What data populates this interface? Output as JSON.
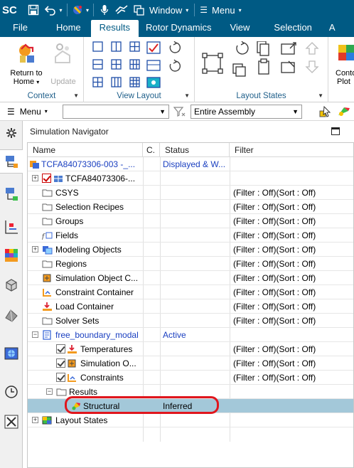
{
  "titlebar": {
    "app_logo": "SC",
    "window_label": "Window",
    "menu_label": "Menu",
    "icons": [
      "save-icon",
      "undo-icon",
      "selection-filter-icon",
      "microphone-icon",
      "touch-mode-icon",
      "window-icon",
      "hamburger-menu-icon"
    ]
  },
  "tabs": [
    {
      "label": "File",
      "active": false
    },
    {
      "label": "Home",
      "active": false
    },
    {
      "label": "Results",
      "active": true
    },
    {
      "label": "Rotor Dynamics",
      "active": false
    },
    {
      "label": "View",
      "active": false
    },
    {
      "label": "Selection",
      "active": false
    },
    {
      "label": "A",
      "active": false
    }
  ],
  "ribbon": {
    "context": {
      "label": "Context",
      "return_to_home_line1": "Return to",
      "return_to_home_line2": "Home",
      "update": "Update"
    },
    "view_layout": {
      "label": "View Layout"
    },
    "layout_states": {
      "label": "Layout States"
    },
    "contour_plot_line1": "Conto",
    "contour_plot_line2": "Plot"
  },
  "toolbar": {
    "menu_label": "Menu",
    "filter_combo_value": "",
    "assembly_combo_value": "Entire Assembly"
  },
  "navigator": {
    "title": "Simulation Navigator",
    "columns": {
      "name": "Name",
      "c": "C.",
      "status": "Status",
      "filter": "Filter"
    },
    "rows": [
      {
        "name": "TCFA84073306-003 -_...",
        "status": "Displayed & W...",
        "filter": ""
      },
      {
        "name": "TCFA84073306-...",
        "status": "",
        "filter": ""
      },
      {
        "name": "CSYS",
        "status": "",
        "filter": "(Filter : Off)(Sort : Off)"
      },
      {
        "name": "Selection Recipes",
        "status": "",
        "filter": "(Filter : Off)(Sort : Off)"
      },
      {
        "name": "Groups",
        "status": "",
        "filter": "(Filter : Off)(Sort : Off)"
      },
      {
        "name": "Fields",
        "status": "",
        "filter": "(Filter : Off)(Sort : Off)"
      },
      {
        "name": "Modeling Objects",
        "status": "",
        "filter": "(Filter : Off)(Sort : Off)"
      },
      {
        "name": "Regions",
        "status": "",
        "filter": "(Filter : Off)(Sort : Off)"
      },
      {
        "name": "Simulation Object C...",
        "status": "",
        "filter": "(Filter : Off)(Sort : Off)"
      },
      {
        "name": "Constraint Container",
        "status": "",
        "filter": "(Filter : Off)(Sort : Off)"
      },
      {
        "name": "Load Container",
        "status": "",
        "filter": "(Filter : Off)(Sort : Off)"
      },
      {
        "name": "Solver Sets",
        "status": "",
        "filter": "(Filter : Off)(Sort : Off)"
      },
      {
        "name": "free_boundary_modal",
        "status": "Active",
        "filter": ""
      },
      {
        "name": "Temperatures",
        "status": "",
        "filter": "(Filter : Off)(Sort : Off)"
      },
      {
        "name": "Simulation O...",
        "status": "",
        "filter": "(Filter : Off)(Sort : Off)"
      },
      {
        "name": "Constraints",
        "status": "",
        "filter": "(Filter : Off)(Sort : Off)"
      },
      {
        "name": "Results",
        "status": "",
        "filter": ""
      },
      {
        "name": "Structural",
        "status": "Inferred",
        "filter": ""
      },
      {
        "name": "Layout States",
        "status": "",
        "filter": ""
      }
    ]
  },
  "colors": {
    "titlebar_bg": "#005a84",
    "selected_row": "#a3c8d9",
    "highlight_ring": "#e0161d",
    "link_blue": "#1a3fc0"
  }
}
